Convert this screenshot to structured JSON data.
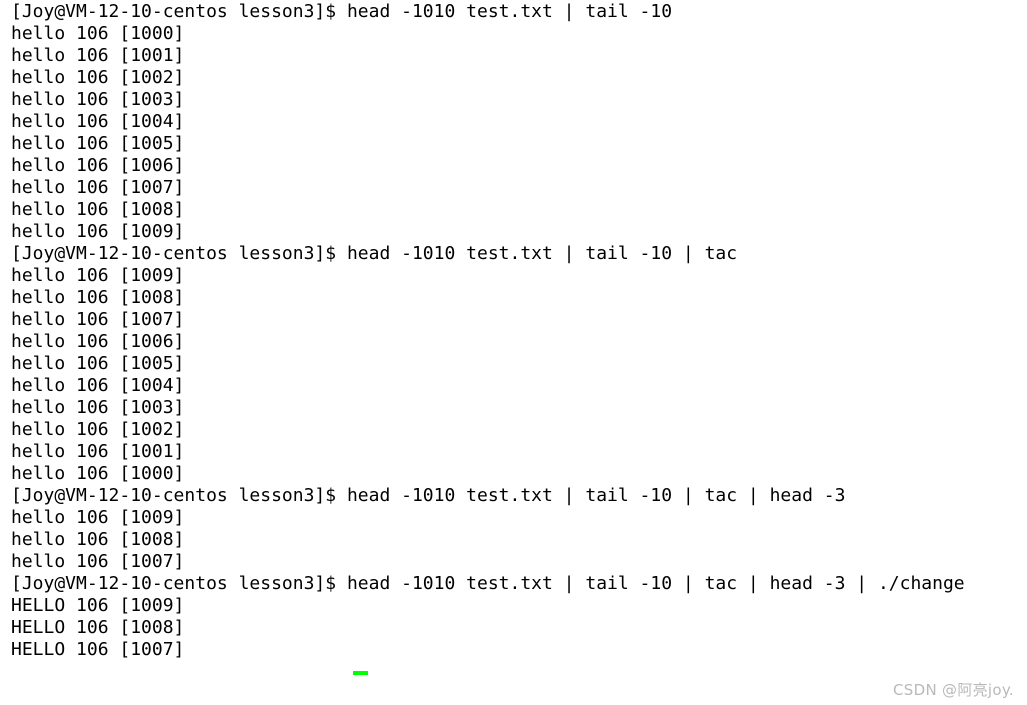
{
  "terminal": {
    "prompt": "[Joy@VM-12-10-centos lesson3]$ ",
    "cursor_color": "#00ff00",
    "text_color": "#000000",
    "background_color": "#ffffff",
    "lines": [
      {
        "type": "prompt",
        "text": "[Joy@VM-12-10-centos lesson3]$ head -1010 test.txt | tail -10"
      },
      {
        "type": "output",
        "text": "hello 106 [1000]"
      },
      {
        "type": "output",
        "text": "hello 106 [1001]"
      },
      {
        "type": "output",
        "text": "hello 106 [1002]"
      },
      {
        "type": "output",
        "text": "hello 106 [1003]"
      },
      {
        "type": "output",
        "text": "hello 106 [1004]"
      },
      {
        "type": "output",
        "text": "hello 106 [1005]"
      },
      {
        "type": "output",
        "text": "hello 106 [1006]"
      },
      {
        "type": "output",
        "text": "hello 106 [1007]"
      },
      {
        "type": "output",
        "text": "hello 106 [1008]"
      },
      {
        "type": "output",
        "text": "hello 106 [1009]"
      },
      {
        "type": "prompt",
        "text": "[Joy@VM-12-10-centos lesson3]$ head -1010 test.txt | tail -10 | tac"
      },
      {
        "type": "output",
        "text": "hello 106 [1009]"
      },
      {
        "type": "output",
        "text": "hello 106 [1008]"
      },
      {
        "type": "output",
        "text": "hello 106 [1007]"
      },
      {
        "type": "output",
        "text": "hello 106 [1006]"
      },
      {
        "type": "output",
        "text": "hello 106 [1005]"
      },
      {
        "type": "output",
        "text": "hello 106 [1004]"
      },
      {
        "type": "output",
        "text": "hello 106 [1003]"
      },
      {
        "type": "output",
        "text": "hello 106 [1002]"
      },
      {
        "type": "output",
        "text": "hello 106 [1001]"
      },
      {
        "type": "output",
        "text": "hello 106 [1000]"
      },
      {
        "type": "prompt",
        "text": "[Joy@VM-12-10-centos lesson3]$ head -1010 test.txt | tail -10 | tac | head -3"
      },
      {
        "type": "output",
        "text": "hello 106 [1009]"
      },
      {
        "type": "output",
        "text": "hello 106 [1008]"
      },
      {
        "type": "output",
        "text": "hello 106 [1007]"
      },
      {
        "type": "prompt",
        "text": "[Joy@VM-12-10-centos lesson3]$ head -1010 test.txt | tail -10 | tac | head -3 | ./change"
      },
      {
        "type": "output",
        "text": "HELLO 106 [1009]"
      },
      {
        "type": "output",
        "text": "HELLO 106 [1008]"
      },
      {
        "type": "output",
        "text": "HELLO 106 [1007]"
      }
    ]
  },
  "watermark": {
    "text": "CSDN @阿亮joy."
  }
}
